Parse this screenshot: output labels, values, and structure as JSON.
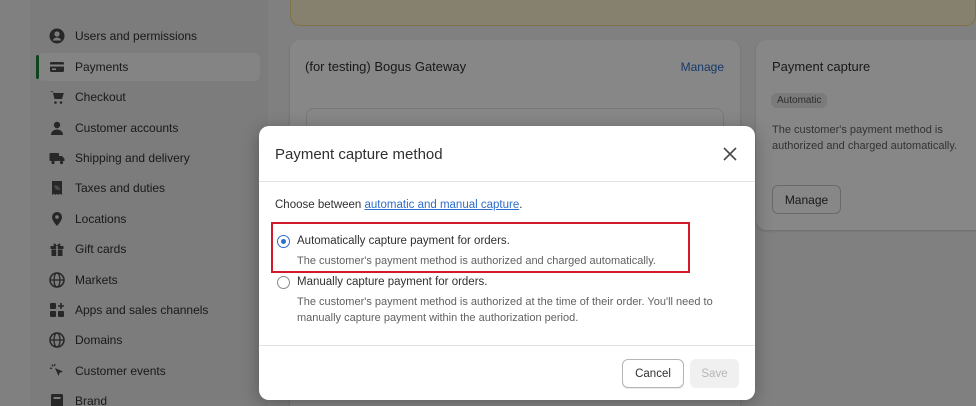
{
  "sidebar": {
    "items": [
      {
        "label": "Users and permissions",
        "icon": "user-icon"
      },
      {
        "label": "Payments",
        "icon": "payments-icon",
        "active": true
      },
      {
        "label": "Checkout",
        "icon": "cart-icon"
      },
      {
        "label": "Customer accounts",
        "icon": "person-icon"
      },
      {
        "label": "Shipping and delivery",
        "icon": "truck-icon"
      },
      {
        "label": "Taxes and duties",
        "icon": "tax-icon"
      },
      {
        "label": "Locations",
        "icon": "location-pin-icon"
      },
      {
        "label": "Gift cards",
        "icon": "gift-icon"
      },
      {
        "label": "Markets",
        "icon": "globe-icon"
      },
      {
        "label": "Apps and sales channels",
        "icon": "apps-icon"
      },
      {
        "label": "Domains",
        "icon": "globe-icon"
      },
      {
        "label": "Customer events",
        "icon": "cursor-click-icon"
      },
      {
        "label": "Brand",
        "icon": "brand-icon"
      }
    ]
  },
  "gateway": {
    "title": "(for testing) Bogus Gateway",
    "manage_label": "Manage"
  },
  "capture_card": {
    "title": "Payment capture",
    "badge": "Automatic",
    "description": "The customer's payment method is authorized and charged automatically.",
    "manage_label": "Manage"
  },
  "modal": {
    "title": "Payment capture method",
    "choose_prefix": "Choose between ",
    "choose_link": "automatic and manual capture",
    "choose_suffix": ".",
    "options": [
      {
        "label": "Automatically capture payment for orders.",
        "help": "The customer's payment method is authorized and charged automatically.",
        "selected": true
      },
      {
        "label": "Manually capture payment for orders.",
        "help": "The customer's payment method is authorized at the time of their order. You'll need to manually capture payment within the authorization period.",
        "selected": false
      }
    ],
    "cancel_label": "Cancel",
    "save_label": "Save"
  },
  "colors": {
    "accent": "#2c6ecb",
    "highlight_border": "#d11a2a",
    "active_indicator": "#1a7f37"
  }
}
